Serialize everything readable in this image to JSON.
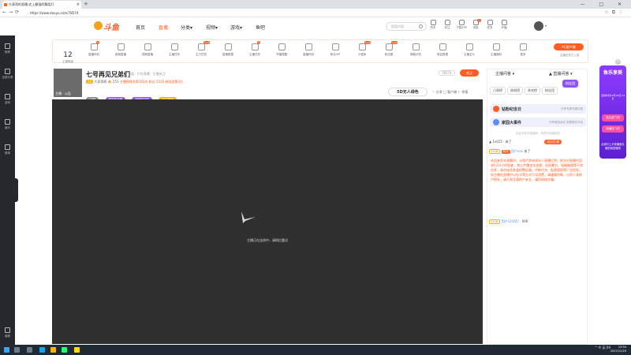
{
  "browser": {
    "tab_title": "大表哥的直播,史上最强的舞蹈打",
    "new_tab": "+",
    "url": "https://www.douyu.com/78574",
    "window_controls": "— □ ✕"
  },
  "sidebar": {
    "items": [
      {
        "label": "推荐",
        "icon": "recommend-icon"
      },
      {
        "label": "全部分类",
        "icon": "category-icon"
      },
      {
        "label": "游戏",
        "icon": "game-icon"
      },
      {
        "label": "娱乐",
        "icon": "entertainment-icon"
      },
      {
        "label": "赛事",
        "icon": "trophy-icon"
      }
    ],
    "bottom_item": {
      "label": "客服",
      "icon": "headset-icon"
    }
  },
  "header": {
    "logo_text": "斗鱼",
    "nav": [
      "首页",
      "直播",
      "分类▾",
      "视频▾",
      "游戏▾",
      "鱼吧"
    ],
    "active_nav": 1,
    "search_placeholder": "搜索内容",
    "icons": [
      {
        "label": "历史",
        "icon": "history-icon"
      },
      {
        "label": "关注",
        "icon": "heart-icon"
      },
      {
        "label": "下载APP",
        "icon": "download-icon"
      },
      {
        "label": "消息",
        "icon": "message-icon",
        "badge": "1"
      },
      {
        "label": "任务",
        "icon": "task-icon"
      },
      {
        "label": "开播",
        "icon": "broadcast-icon"
      }
    ]
  },
  "toolbar": {
    "level_num": "12",
    "level_label": "主播等级",
    "items": [
      {
        "label": "直播伴侣",
        "icon": "companion-icon",
        "badge": "1"
      },
      {
        "label": "音频直播",
        "icon": "audio-wave-icon"
      },
      {
        "label": "视频直播",
        "icon": "video-icon"
      },
      {
        "label": "主播任务",
        "icon": "task-icon"
      },
      {
        "label": "主力任务",
        "icon": "star-icon",
        "badge": "new"
      },
      {
        "label": "直播数据",
        "icon": "shield-icon"
      },
      {
        "label": "主播任务",
        "icon": "checklist-icon",
        "badge": "1"
      },
      {
        "label": "开播提醒",
        "icon": "alarm-icon"
      },
      {
        "label": "直播伴侣",
        "icon": "gift-icon"
      },
      {
        "label": "粉丝VIP",
        "icon": "diamond-icon"
      },
      {
        "label": "小程序",
        "icon": "cloud-icon",
        "badge": "new"
      },
      {
        "label": "粉丝团",
        "icon": "user-icon",
        "badge": "new"
      },
      {
        "label": "弹幕分析",
        "icon": "gauge-icon"
      },
      {
        "label": "收益数据",
        "icon": "robot-icon"
      },
      {
        "label": "主播名片",
        "icon": "edit-icon"
      },
      {
        "label": "主播福利",
        "icon": "wallet-icon"
      },
      {
        "label": "更多",
        "icon": "more-icon"
      }
    ],
    "pc_client": "PC客户端",
    "pc_client_sub": "主播任务已上线"
  },
  "room": {
    "title": "七号再见兄弟们",
    "category": "分类 · 户外直播 · 主播关注",
    "streamer_tag": "主播 · 公告",
    "level": "22",
    "info_text": "大表哥啊",
    "hot": "253",
    "rank_text": "主播榜排名第165名",
    "fans": "粉丝 5535",
    "fans_rank": "粉丝团第3位",
    "room_id": "78574",
    "follow_label": "关注",
    "badges": [
      {
        "label": "LV88",
        "color": "#8a8a8a"
      },
      {
        "label": "超级粉丝牌",
        "color": "#9153ff"
      },
      {
        "label": "超级粉丝团",
        "color": "#9153ff"
      },
      {
        "label": "UP主等级",
        "color": "#f7b500"
      }
    ],
    "sponsor": "5D无人绿色",
    "actions": "♡ 分享   □ 客户端   ⚐ 举报"
  },
  "video": {
    "message": "主播正在连线中，请稍后重试"
  },
  "right_panel": {
    "top_left": "主播问答 ▾",
    "top_right": "▲ 直播问答 ▾",
    "tabs": [
      "日周榜",
      "周周榜",
      "贵宾榜",
      "粉丝团"
    ],
    "active_tab_label": "粉丝团",
    "cards": [
      {
        "title": "钻粉纪念日",
        "sub": "分享专属专属礼物",
        "color": "#ff5d23"
      },
      {
        "title": "家园大事件",
        "sub": "分享家园动态 查看精彩内容",
        "color": "#5d8cff"
      }
    ],
    "hint": "欢迎来到本直播间，请遵守直播规范",
    "gift_row_user": "▲ 1x025 · 来了",
    "gift_row_chip": "送出礼物",
    "msg_lv": "LV18",
    "msg_chip": "粉丝",
    "msg_user": "用户xxx",
    "msg_text": "来了",
    "notice": "欢迎来到本直播间，斗鱼严禁未成年人直播打赏，依法对直播内容进行24小时巡查，禁止传播违法违规、低俗暴力、吸烟酗酒等不良信息，请勿轻信各类招聘征婚、代练代充、股票理财等广告信息，如主播在直播中以办卡等方式引导消费，请谨慎判断，以防人身财产损失。请大家注意财产安全，谨防网络诈骗。",
    "last_lv": "LV18",
    "last_user": "用户12345：",
    "last_text": "666"
  },
  "promo": {
    "title": "鱼乐享美",
    "date": "活动时间12月18日-24日",
    "buttons": [
      "鱼丸送飞机",
      "鱼塘送飞机"
    ],
    "foot": "点我可上头条赚鱼丸 赚到就是赚到"
  },
  "taskbar": {
    "tray": "^ 中 英 69",
    "time": "15:54",
    "date": "2022/12/20"
  }
}
